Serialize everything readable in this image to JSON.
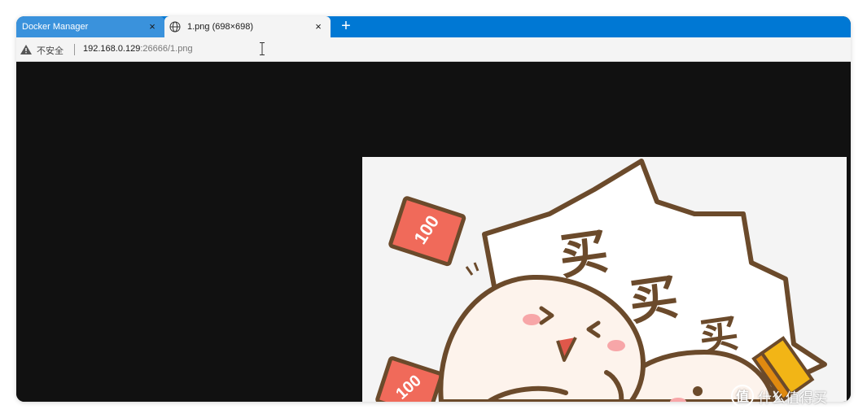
{
  "tabs": [
    {
      "label": "Docker Manager",
      "active": false
    },
    {
      "label": "1.png (698×698)",
      "active": true
    }
  ],
  "tab_close_glyph": "×",
  "new_tab_glyph": "+",
  "addressbar": {
    "security_label": "不安全",
    "url_host": "192.168.0.129",
    "url_rest": ":26666/1.png"
  },
  "image_text": {
    "note1": "100",
    "note2": "100",
    "word1": "买",
    "word2": "买",
    "word3": "买"
  },
  "watermark": {
    "text": "什么值得买"
  },
  "colors": {
    "tabbar": "#0078d4",
    "viewer_bg": "#111111",
    "outline": "#6b4a2b",
    "face": "#fdf3ec",
    "note": "#f06a5a",
    "gold": "#f2b516"
  }
}
